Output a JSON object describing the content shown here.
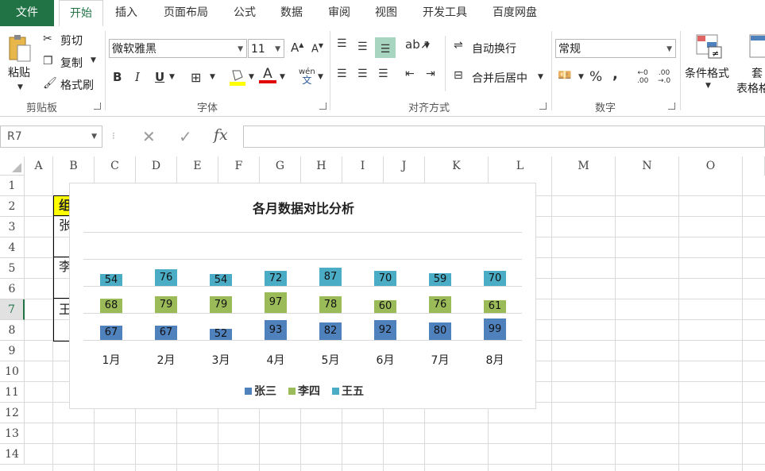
{
  "tabs": [
    {
      "label": "文件"
    },
    {
      "label": "开始"
    },
    {
      "label": "插入"
    },
    {
      "label": "页面布局"
    },
    {
      "label": "公式"
    },
    {
      "label": "数据"
    },
    {
      "label": "审阅"
    },
    {
      "label": "视图"
    },
    {
      "label": "开发工具"
    },
    {
      "label": "百度网盘"
    }
  ],
  "clipboard": {
    "paste": "粘贴",
    "cut": "剪切",
    "copy": "复制",
    "format_painter": "格式刷",
    "group": "剪贴板"
  },
  "font": {
    "name": "微软雅黑",
    "size": "11",
    "bold": "B",
    "italic": "I",
    "underline": "U",
    "group": "字体"
  },
  "alignment": {
    "wrap": "自动换行",
    "merge": "合并后居中",
    "group": "对齐方式"
  },
  "number": {
    "format": "常规",
    "percent": "%",
    "comma": ",",
    "group": "数字"
  },
  "styles": {
    "conditional": "条件格式",
    "table_top": "套",
    "table_bottom": "表格格"
  },
  "formula_bar": {
    "name_box": "R7",
    "fx": "fx",
    "value": ""
  },
  "columns": [
    "A",
    "B",
    "C",
    "D",
    "E",
    "F",
    "G",
    "H",
    "I",
    "J",
    "K",
    "L",
    "M",
    "N",
    "O"
  ],
  "rows": [
    "1",
    "2",
    "3",
    "4",
    "5",
    "6",
    "7",
    "8",
    "9",
    "10",
    "11",
    "12",
    "13",
    "14"
  ],
  "cells": {
    "b2": "组",
    "b3": "张",
    "b5": "李",
    "b7": "王"
  },
  "colors": {
    "excel_green": "#217346",
    "series_zhang": "#4f81bd",
    "series_li": "#9bbb59",
    "series_wang": "#4bacc6",
    "cell_highlight": "#ffff00"
  },
  "chart_data": {
    "type": "bar",
    "title": "各月数据对比分析",
    "categories": [
      "1月",
      "2月",
      "3月",
      "4月",
      "5月",
      "6月",
      "7月",
      "8月"
    ],
    "series": [
      {
        "name": "张三",
        "values": [
          67,
          67,
          52,
          93,
          82,
          92,
          80,
          99
        ]
      },
      {
        "name": "李四",
        "values": [
          68,
          79,
          79,
          97,
          78,
          60,
          76,
          61
        ]
      },
      {
        "name": "王五",
        "values": [
          54,
          76,
          54,
          72,
          87,
          70,
          59,
          70
        ]
      }
    ],
    "legend": "bottom",
    "grid": true
  }
}
